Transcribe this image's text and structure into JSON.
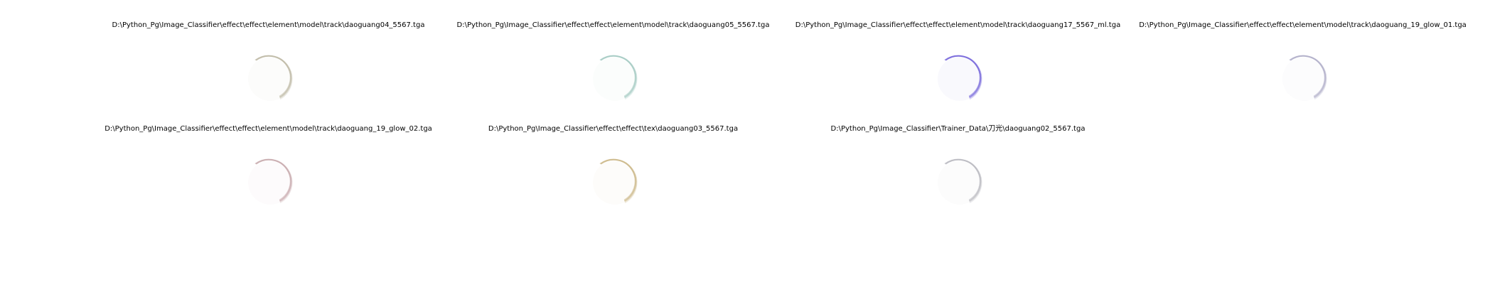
{
  "figure": {
    "panels": [
      {
        "title": "D:\\Python_Pg\\Image_Classifier\\effect\\effect\\element\\model\\track\\daoguang04_5567.tga",
        "tint": "#b9b39e"
      },
      {
        "title": "D:\\Python_Pg\\Image_Classifier\\effect\\effect\\element\\model\\track\\daoguang05_5567.tga",
        "tint": "#9cc6be"
      },
      {
        "title": "D:\\Python_Pg\\Image_Classifier\\effect\\effect\\element\\model\\track\\daoguang17_5567_ml.tga",
        "tint": "#6b5ad8"
      },
      {
        "title": "D:\\Python_Pg\\Image_Classifier\\effect\\effect\\element\\model\\track\\daoguang_19_glow_01.tga",
        "tint": "#a9a7c4"
      },
      {
        "title": "D:\\Python_Pg\\Image_Classifier\\effect\\effect\\element\\model\\track\\daoguang_19_glow_02.tga",
        "tint": "#c3a3a6"
      },
      {
        "title": "D:\\Python_Pg\\Image_Classifier\\effect\\effect\\tex\\daoguang03_5567.tga",
        "tint": "#c8b27e"
      },
      {
        "title": "D:\\Python_Pg\\Image_Classifier\\Trainer_Data\\刀光\\daoguang02_5567.tga",
        "tint": "#b4b4bb"
      }
    ]
  }
}
